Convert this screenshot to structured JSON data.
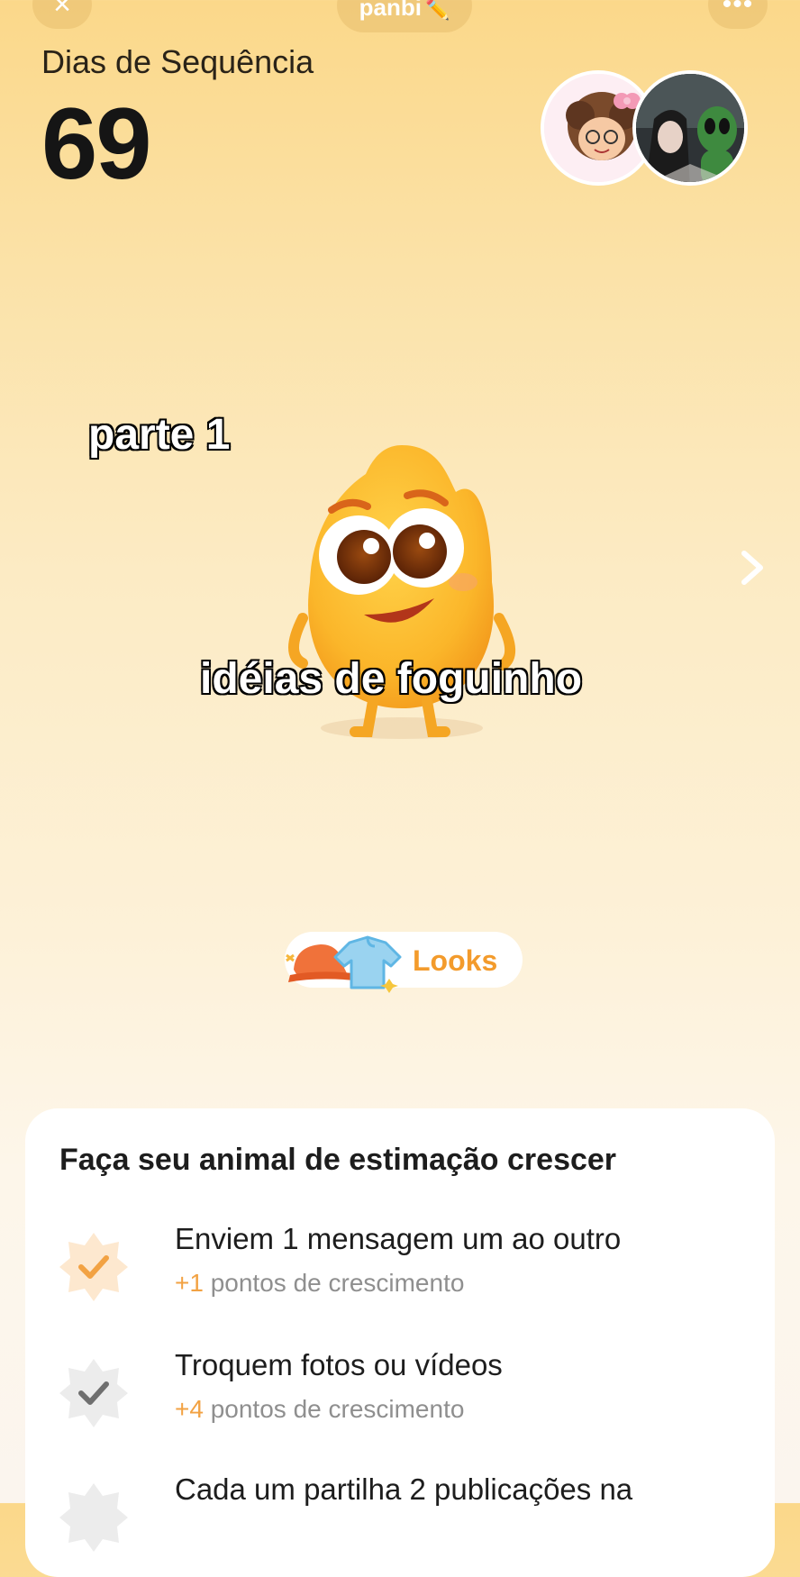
{
  "header": {
    "title": "panbi",
    "title_emoji": "✏️",
    "close_icon": "close-icon",
    "more_icon": "more-dots-icon"
  },
  "streak": {
    "label": "Dias de Sequência",
    "count": "69"
  },
  "captions": {
    "part": "parte 1",
    "main": "idéias de foguinho"
  },
  "looks": {
    "label": "Looks"
  },
  "tasks": {
    "title": "Faça seu animal de estimação crescer",
    "items": [
      {
        "title": "Enviem 1 mensagem um ao outro",
        "points": "+1",
        "unit": "pontos de crescimento",
        "status": "done"
      },
      {
        "title": "Troquem fotos ou vídeos",
        "points": "+4",
        "unit": "pontos de crescimento",
        "status": "pending"
      },
      {
        "title": "Cada um partilha 2 publicações na",
        "points": "",
        "unit": "",
        "status": "pending"
      }
    ]
  },
  "colors": {
    "accent": "#f39b2c",
    "points": "#f2a243",
    "mascot": "#fbb62a"
  }
}
